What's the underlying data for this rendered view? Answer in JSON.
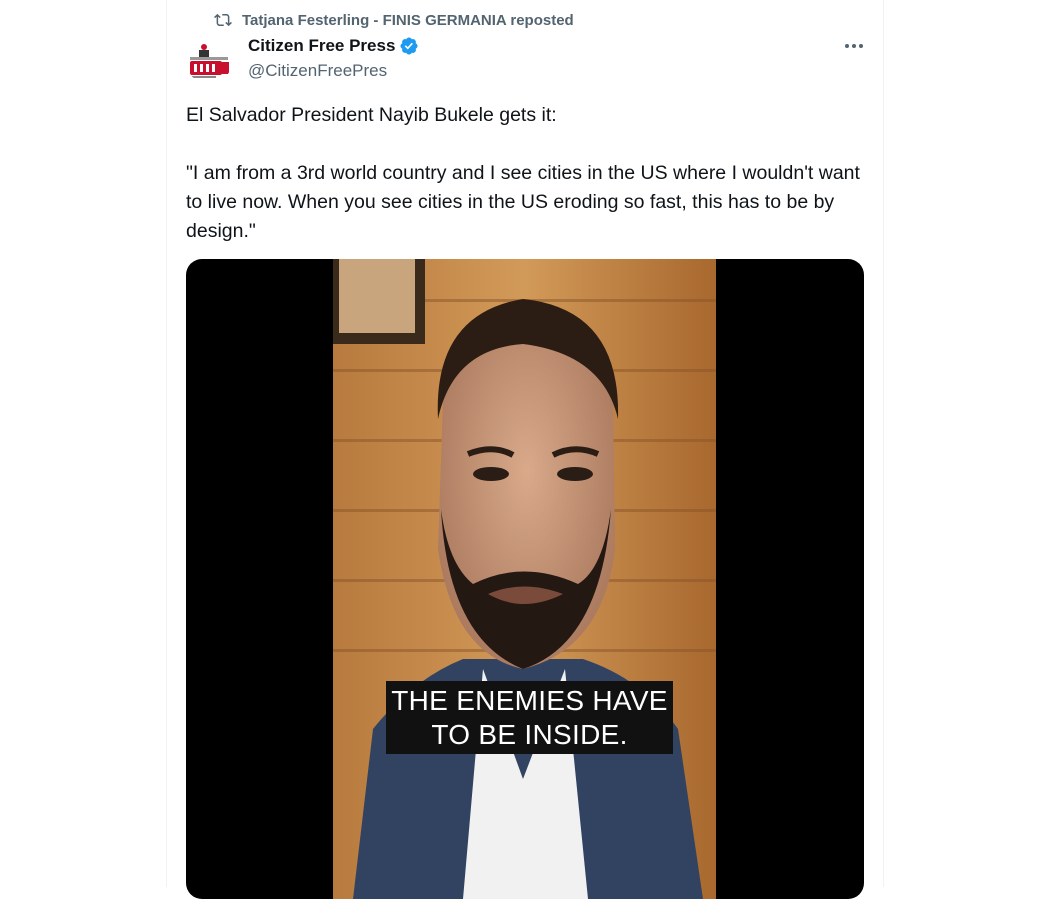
{
  "repost": {
    "icon": "repost-icon",
    "text": "Tatjana Festerling - FINIS GERMANIA reposted"
  },
  "author": {
    "name": "Citizen Free Press",
    "handle": "@CitizenFreePres",
    "verified": true,
    "verified_color": "#1d9bf0"
  },
  "tweet": {
    "paragraph1": "El Salvador President Nayib Bukele gets it:",
    "paragraph2": "\"I am from a 3rd world country and I see cities in the US where I wouldn't want to live now. When you see cities in the US eroding so fast, this has to be by design.\""
  },
  "video": {
    "caption_line1": "THE ENEMIES HAVE",
    "caption_line2": "TO BE INSIDE."
  },
  "icons": {
    "more": "more-options-icon",
    "verified": "verified-badge-icon"
  }
}
